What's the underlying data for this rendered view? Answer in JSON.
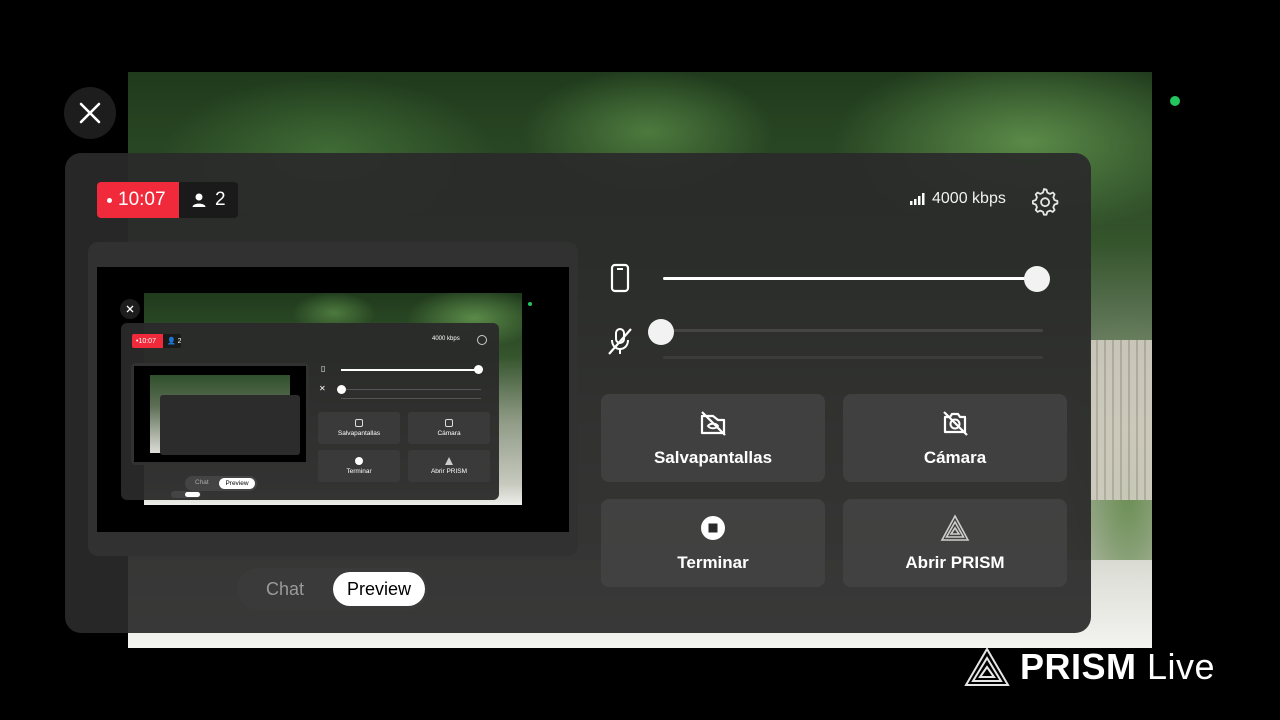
{
  "stream": {
    "live_time": "10:07",
    "viewer_count": "2",
    "bitrate": "4000 kbps"
  },
  "controls": {
    "device_volume": 1.0,
    "mic_volume": 0.0,
    "mic_muted": true,
    "screensaver_label": "Salvapantallas",
    "camera_label": "Cámara",
    "end_label": "Terminar",
    "open_prism_label": "Abrir PRISM"
  },
  "tabs": {
    "chat_label": "Chat",
    "preview_label": "Preview",
    "selected": "Preview"
  },
  "brand": {
    "name_bold": "PRISM",
    "name_light": "Live"
  },
  "colors": {
    "live_red": "#f0293b",
    "status_green": "#22c55e"
  }
}
